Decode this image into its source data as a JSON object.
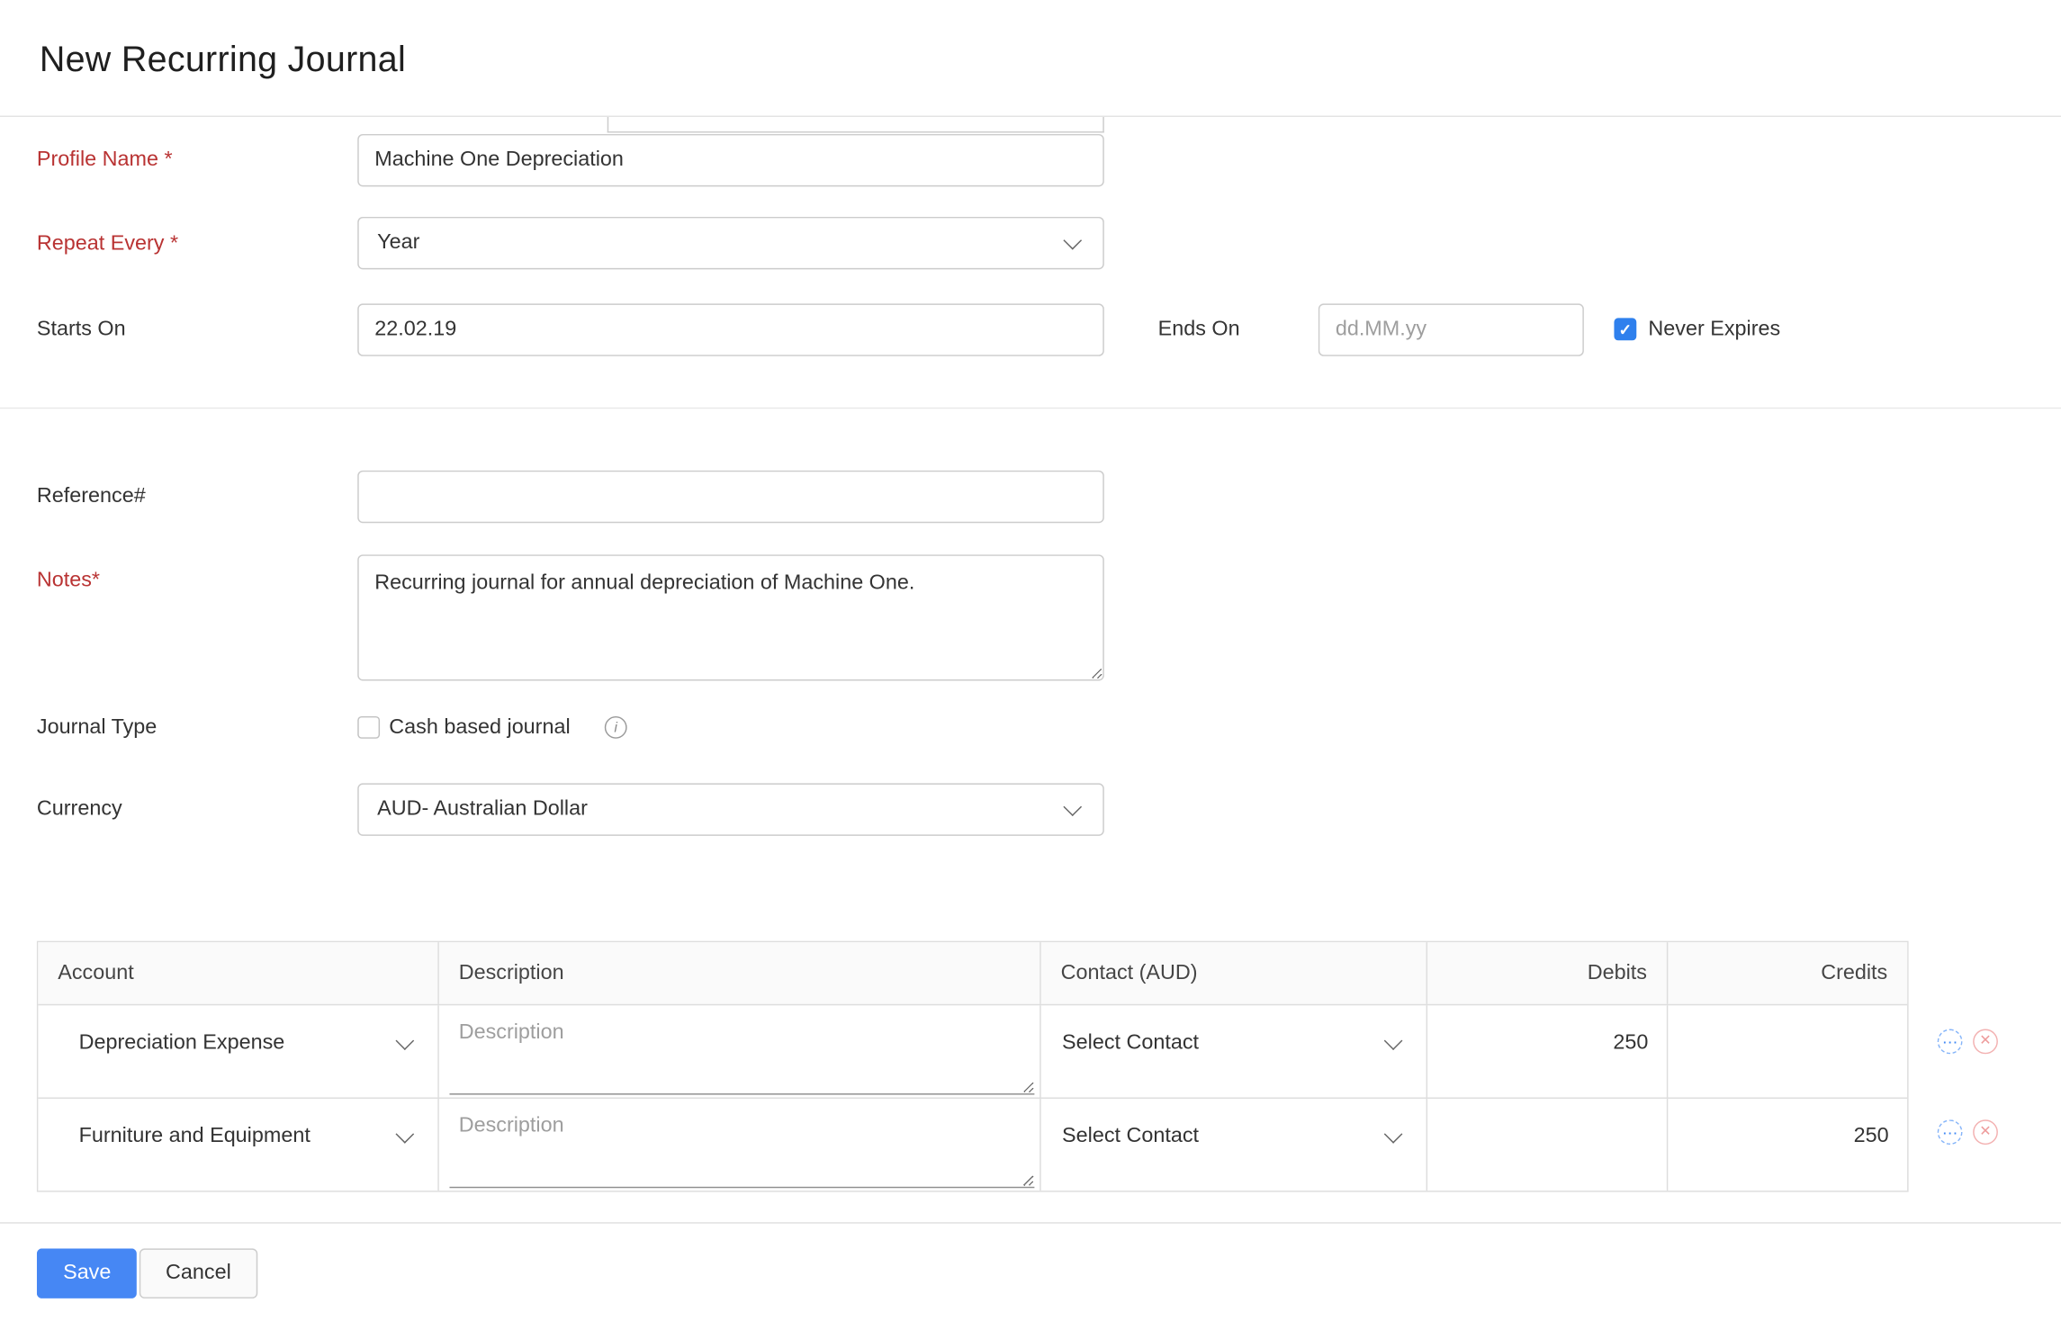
{
  "page": {
    "title": "New Recurring Journal"
  },
  "icons": {
    "checkmark": "✓",
    "info": "i",
    "more_dots": "⋯",
    "delete_cross": "✕"
  },
  "colors": {
    "required_label": "#b93333",
    "accent_blue": "#2f80ed",
    "save_blue": "#4687f4",
    "placeholder_gray": "#9e9e9e"
  },
  "form": {
    "profile_name": {
      "label": "Profile Name *",
      "value": "Machine One Depreciation"
    },
    "repeat_every": {
      "label": "Repeat Every *",
      "value": "Year"
    },
    "starts_on": {
      "label": "Starts On",
      "value": "22.02.19"
    },
    "ends_on": {
      "label": "Ends On",
      "placeholder": "dd.MM.yy"
    },
    "never_expires": {
      "label": "Never Expires",
      "checked": true
    },
    "reference": {
      "label": "Reference#",
      "value": ""
    },
    "notes": {
      "label": "Notes*",
      "value": "Recurring journal for annual depreciation of Machine One."
    },
    "journal_type": {
      "label": "Journal Type",
      "checkbox_label": "Cash based journal",
      "checked": false
    },
    "currency": {
      "label": "Currency",
      "value": "AUD- Australian Dollar"
    }
  },
  "table": {
    "headers": [
      "Account",
      "Description",
      "Contact (AUD)",
      "Debits",
      "Credits"
    ],
    "rows": [
      {
        "account": "Depreciation Expense",
        "description_placeholder": "Description",
        "contact": "Select Contact",
        "debits": "250",
        "credits": ""
      },
      {
        "account": "Furniture and Equipment",
        "description_placeholder": "Description",
        "contact": "Select Contact",
        "debits": "",
        "credits": "250"
      }
    ]
  },
  "actions": {
    "save": "Save",
    "cancel": "Cancel"
  }
}
